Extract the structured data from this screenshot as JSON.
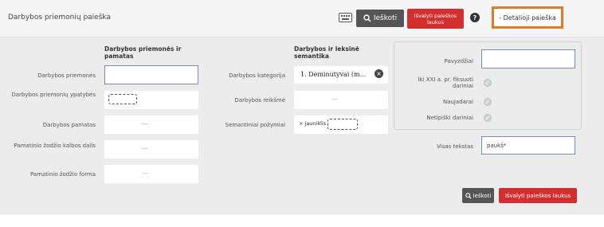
{
  "header": {
    "title": "Darbybos priemonių paieška",
    "search_label": "Ieškoti",
    "clear_label": "Išvalyti paieškos laukus",
    "help_label": "?",
    "detail_label": "- Detalioji paieška"
  },
  "columns": {
    "col1": "Darbybos priemonės ir pamatas",
    "col2": "Darbybos ir leksinė semantika"
  },
  "left_fields": {
    "priemones": "Darbybos priemonės",
    "ypatybes": "Darbybos priemonių ypatybės",
    "pamatas": "Darbybos pamatas",
    "kalbos_dalis": "Pamatinio žodžio kalbos dalis",
    "forma": "Pamatinio žodžio forma",
    "empty_placeholder": "---"
  },
  "mid_fields": {
    "kategorija_label": "Darbybos kategorija",
    "kategorija_value": "1. Deminutyvai (m...",
    "reiksme_label": "Darbybos reikšmė",
    "pozymiai_label": "Semantiniai požymiai",
    "pozymiai_tag": "× jauniklis",
    "empty_placeholder": "---"
  },
  "right_fields": {
    "pavyzdziai": "Pavyzdžiai",
    "iki_xxi": "Iki XXI a. pr. fiksuoti dariniai",
    "naujadarai": "Naujadarai",
    "netipiski": "Netipiški dariniai",
    "visas_tekstas": "Visas tekstas",
    "visas_tekstas_value": "paukš*"
  },
  "footer": {
    "search_label": "Ieškoti",
    "clear_label": "Išvalyti paieškos laukus"
  },
  "colors": {
    "accent_red": "#d32f2f",
    "highlight_orange": "#e87722",
    "button_gray": "#555555"
  }
}
